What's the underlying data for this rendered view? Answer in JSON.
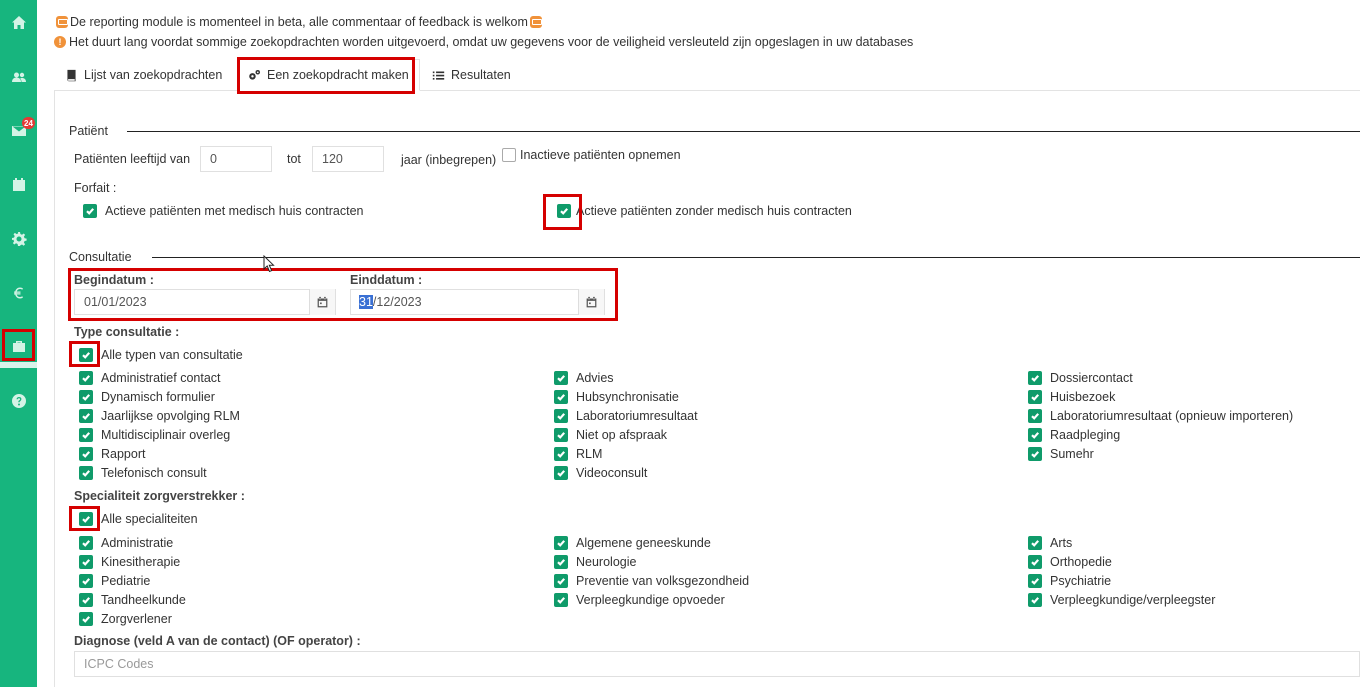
{
  "sidebar": {
    "items": [
      "home-icon",
      "users-icon",
      "mail-icon",
      "calendar-icon",
      "gear-icon",
      "euro-icon",
      "reporting-icon",
      "help-icon"
    ],
    "mail_badge": "24"
  },
  "notices": {
    "beta": "De reporting module is momenteel in beta, alle commentaar of feedback is welkom",
    "info": "Het duurt lang voordat sommige zoekopdrachten worden uitgevoerd, omdat uw gegevens voor de veiligheid versleuteld zijn opgeslagen in uw databases"
  },
  "tabs": [
    {
      "label": "Lijst van zoekopdrachten",
      "icon": "book-icon"
    },
    {
      "label": "Een zoekopdracht maken",
      "icon": "gears-icon",
      "active": true
    },
    {
      "label": "Resultaten",
      "icon": "list-icon"
    }
  ],
  "patient": {
    "section_title": "Patiënt",
    "age_label": "Patiënten leeftijd van",
    "age_from": "0",
    "to_label": "tot",
    "age_to": "120",
    "years_label": "jaar (inbegrepen)",
    "inactive_label": "Inactieve patiënten opnemen",
    "inactive_checked": false,
    "forfait_label": "Forfait :",
    "forfait_with": "Actieve patiënten met medisch huis contracten",
    "forfait_without": "Actieve patiënten zonder medisch huis contracten"
  },
  "consultation": {
    "section_title": "Consultatie",
    "begin_label": "Begindatum :",
    "begin_value": "01/01/2023",
    "end_label": "Einddatum :",
    "end_day_selected": "31",
    "end_rest": "/12/2023",
    "type_label": "Type consultatie :",
    "all_types": "Alle typen van consultatie",
    "types": [
      [
        "Administratief contact",
        "Advies",
        "Dossiercontact"
      ],
      [
        "Dynamisch formulier",
        "Hubsynchronisatie",
        "Huisbezoek"
      ],
      [
        "Jaarlijkse opvolging RLM",
        "Laboratoriumresultaat",
        "Laboratoriumresultaat (opnieuw importeren)"
      ],
      [
        "Multidisciplinair overleg",
        "Niet op afspraak",
        "Raadpleging"
      ],
      [
        "Rapport",
        "RLM",
        "Sumehr"
      ],
      [
        "Telefonisch consult",
        "Videoconsult",
        ""
      ]
    ],
    "specialty_label": "Specialiteit zorgverstrekker :",
    "all_specialties": "Alle specialiteiten",
    "specialties": [
      [
        "Administratie",
        "Algemene geneeskunde",
        "Arts"
      ],
      [
        "Kinesitherapie",
        "Neurologie",
        "Orthopedie"
      ],
      [
        "Pediatrie",
        "Preventie van volksgezondheid",
        "Psychiatrie"
      ],
      [
        "Tandheelkunde",
        "Verpleegkundige opvoeder",
        "Verpleegkundige/verpleegster"
      ],
      [
        "Zorgverlener",
        "",
        ""
      ]
    ],
    "diagnosis_label": "Diagnose (veld A van de contact) (OF operator) :",
    "diagnosis_placeholder": "ICPC Codes"
  }
}
